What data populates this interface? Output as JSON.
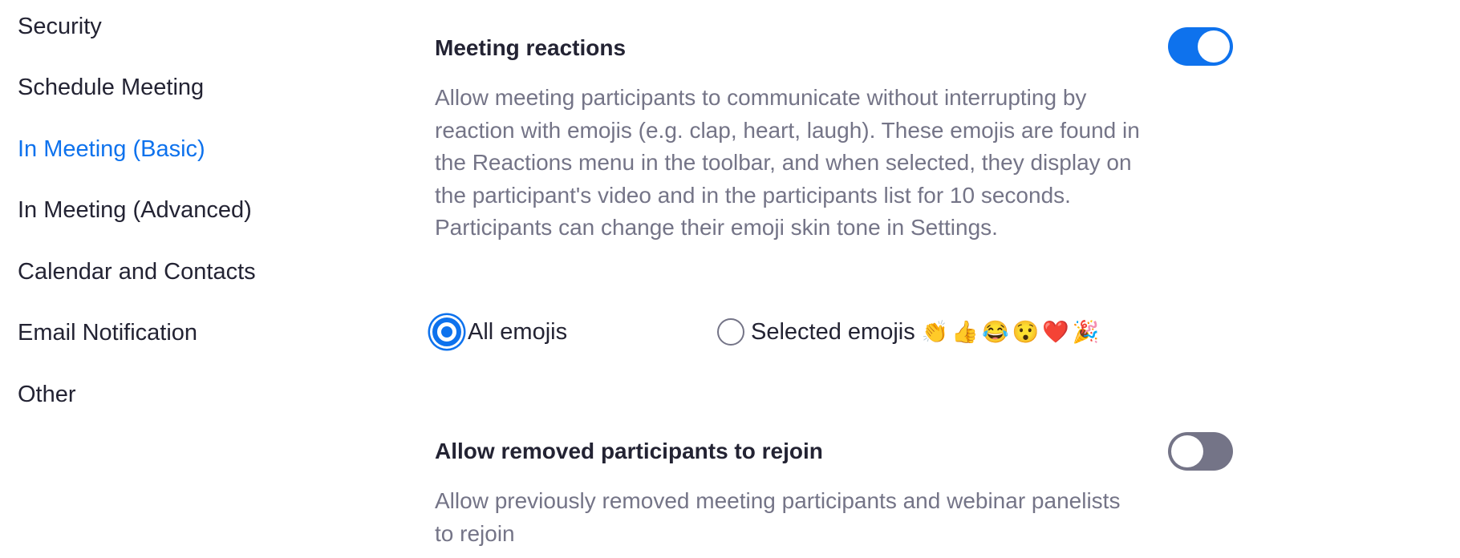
{
  "sidebar": {
    "items": [
      {
        "label": "Security"
      },
      {
        "label": "Schedule Meeting"
      },
      {
        "label": "In Meeting (Basic)"
      },
      {
        "label": "In Meeting (Advanced)"
      },
      {
        "label": "Calendar and Contacts"
      },
      {
        "label": "Email Notification"
      },
      {
        "label": "Other"
      }
    ],
    "active_index": 2
  },
  "settings": [
    {
      "title": "Meeting reactions",
      "description": "Allow meeting participants to communicate without interrupting by reaction with emojis (e.g. clap, heart, laugh). These emojis are found in the Reactions menu in the toolbar, and when selected, they display on the participant's video and in the participants list for 10 seconds. Participants can change their emoji skin tone in Settings.",
      "enabled": true,
      "options": [
        {
          "label": "All emojis",
          "selected": true
        },
        {
          "label": "Selected emojis",
          "selected": false,
          "emojis": [
            "👏",
            "👍",
            "😂",
            "😯",
            "❤️",
            "🎉"
          ]
        }
      ]
    },
    {
      "title": "Allow removed participants to rejoin",
      "description": "Allow previously removed meeting participants and webinar panelists to rejoin",
      "enabled": false
    }
  ],
  "colors": {
    "accent": "#0e72ed",
    "text": "#232333",
    "muted": "#747487",
    "toggle_off": "#747487"
  }
}
